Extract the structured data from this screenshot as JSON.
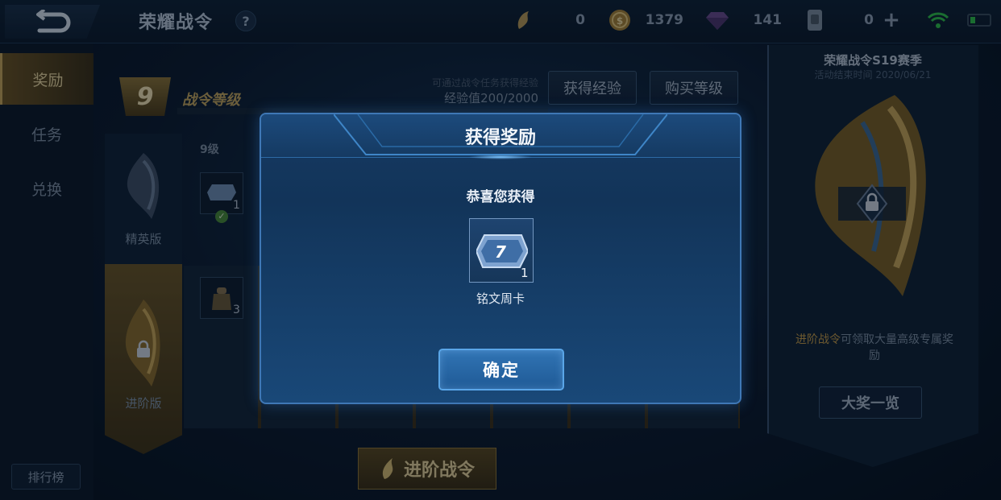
{
  "topbar": {
    "title": "荣耀战令",
    "help": "?",
    "currencies": [
      {
        "icon": "token-icon",
        "value": "0"
      },
      {
        "icon": "gold-coin-icon",
        "value": "1379"
      },
      {
        "icon": "diamond-icon",
        "value": "141"
      },
      {
        "icon": "voucher-icon",
        "value": "0"
      }
    ],
    "plus": "+"
  },
  "nav": {
    "items": [
      {
        "label": "奖励",
        "active": true
      },
      {
        "label": "任务",
        "active": false
      },
      {
        "label": "兑换",
        "active": false
      }
    ],
    "rank_label": "排行榜"
  },
  "pass": {
    "level": "9",
    "level_label": "战令等级",
    "exp_hint": "可通过战令任务获得经验",
    "exp_value": "经验值200/2000",
    "get_exp_label": "获得经验",
    "buy_level_label": "购买等级",
    "elite_label": "精英版",
    "advanced_label": "进阶版",
    "column_level": "9级",
    "elite_reward_count": "1",
    "advanced_reward_count": "3",
    "advanced_button": "进阶战令"
  },
  "right_panel": {
    "title": "荣耀战令S19赛季",
    "date": "活动结束时间 2020/06/21",
    "desc_highlight": "进阶战令",
    "desc_rest": "可领取大量高级专属奖励",
    "prizes_button": "大奖一览"
  },
  "modal": {
    "title": "获得奖励",
    "subtitle": "恭喜您获得",
    "reward": {
      "name": "铭文周卡",
      "count": "1",
      "icon": "rune-week-card-icon",
      "badge": "7"
    },
    "confirm_label": "确定"
  },
  "colors": {
    "accent_gold": "#c9a75a",
    "modal_border": "#3f78b6",
    "confirm_button": "#2a6aa8"
  }
}
